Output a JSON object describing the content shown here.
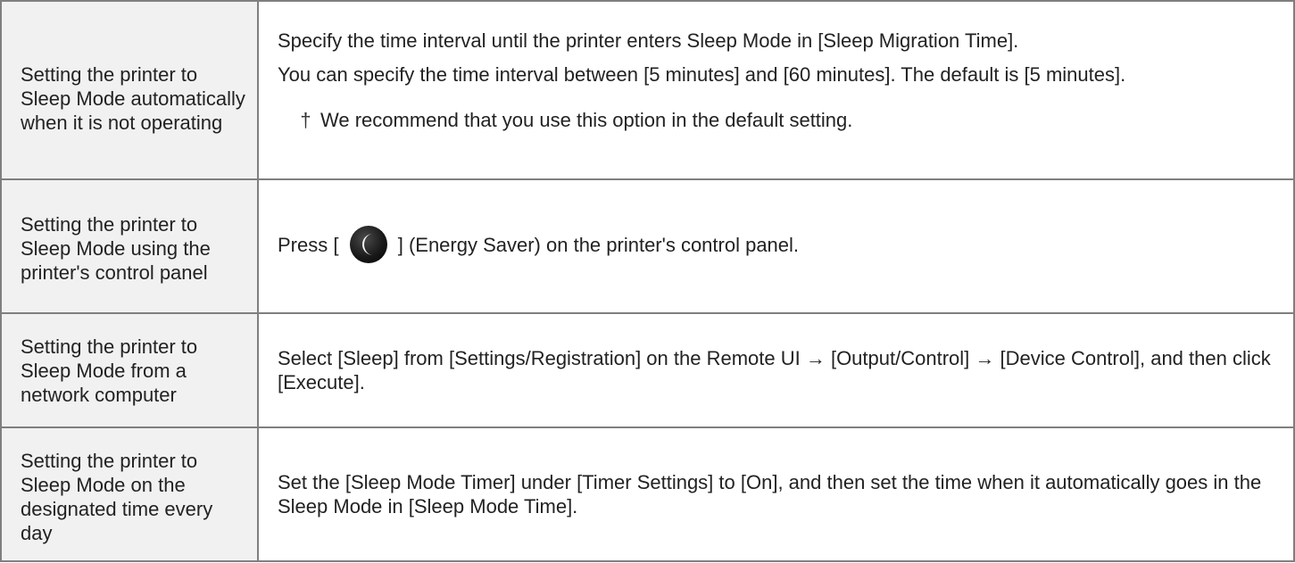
{
  "rows": [
    {
      "label": "Setting the printer to Sleep Mode automatically when it is not operating",
      "paragraphs": [
        "Specify the time interval until the printer enters Sleep Mode in [Sleep Migration Time].",
        "You can specify the time interval between [5 minutes] and [60 minutes]. The default is [5 minutes]."
      ],
      "note": "We recommend that you use this option in the default setting."
    },
    {
      "label": "Setting the printer to Sleep Mode using the printer's control panel",
      "text_before": "Press [",
      "icon": "energy-saver-moon-icon",
      "text_after": "] (Energy Saver) on the printer's control panel."
    },
    {
      "label": "Setting the printer to Sleep Mode from a network computer",
      "text": "Select [Sleep] from [Settings/Registration] on the Remote UI → [Output/Control] → [Device Control], and then click [Execute]."
    },
    {
      "label": "Setting the printer to Sleep Mode on the designated time every day",
      "text": "Set the [Sleep Mode Timer] under [Timer Settings] to [On], and then set the time when it automatically goes in the Sleep Mode in [Sleep Mode Time]."
    }
  ],
  "note_bullet": "†",
  "colors": {
    "label_background": "#f1f1f1",
    "border": "#7f7f7f",
    "text": "#222222"
  }
}
